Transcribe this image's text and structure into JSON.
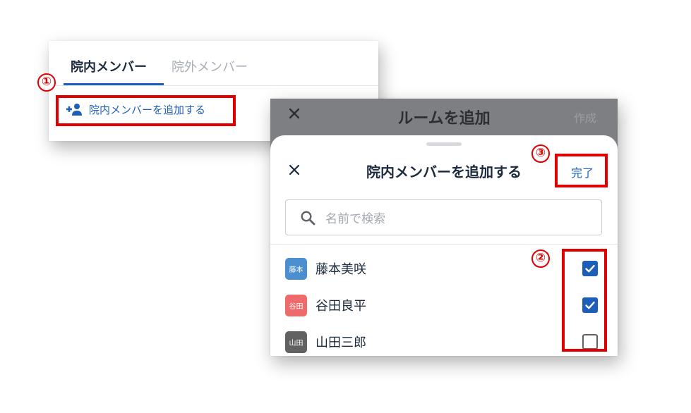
{
  "left_panel": {
    "tabs": [
      {
        "label": "院内メンバー",
        "active": true
      },
      {
        "label": "院外メンバー",
        "active": false
      }
    ],
    "add_member_label": "院内メンバーを追加する",
    "icon": "person-add-icon"
  },
  "right_panel": {
    "header": {
      "title": "ルームを追加",
      "close_icon": "close-icon",
      "create_label": "作成"
    },
    "sheet": {
      "title": "院内メンバーを追加する",
      "done_label": "完了",
      "search_placeholder": "名前で検索",
      "members": [
        {
          "avatar": "藤本",
          "name": "藤本美咲",
          "avatar_color": "#4b8fd1",
          "checked": true
        },
        {
          "avatar": "谷田",
          "name": "谷田良平",
          "avatar_color": "#ef6b6b",
          "checked": true
        },
        {
          "avatar": "山田",
          "name": "山田三郎",
          "avatar_color": "#616161",
          "checked": false
        }
      ]
    }
  },
  "annotations": [
    "①",
    "②",
    "③"
  ],
  "colors": {
    "accent": "#1d5fb8",
    "annotation": "#e00000",
    "header_overlay": "#7d7f82"
  }
}
